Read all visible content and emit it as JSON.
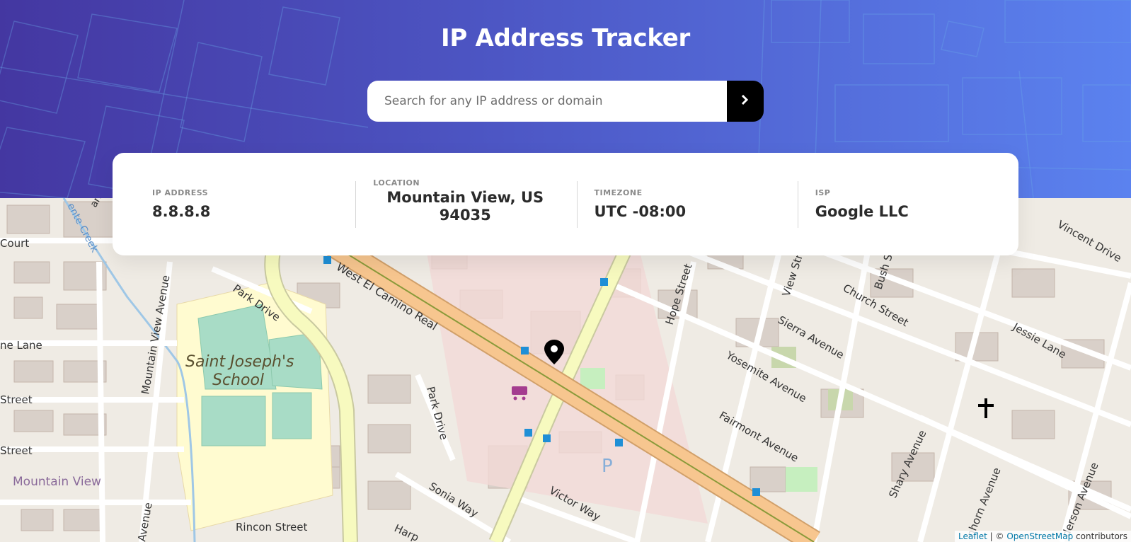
{
  "header": {
    "title": "IP Address Tracker"
  },
  "search": {
    "placeholder": "Search for any IP address or domain",
    "value": ""
  },
  "info": {
    "ip": {
      "label": "IP ADDRESS",
      "value": "8.8.8.8"
    },
    "location": {
      "label": "LOCATION",
      "value": "Mountain View, US 94035"
    },
    "timezone": {
      "label": "TIMEZONE",
      "value": "UTC -08:00"
    },
    "isp": {
      "label": "ISP",
      "value": "Google LLC"
    }
  },
  "map": {
    "labels": {
      "west_el_camino": "West El Camino Real",
      "park_drive_1": "Park Drive",
      "park_drive_2": "Park Drive",
      "mountain_view_ave": "Mountain View Avenue",
      "saint_josephs_1": "Saint Joseph's",
      "saint_josephs_2": "School",
      "hope_street": "Hope Street",
      "sierra_ave": "Sierra Avenue",
      "yosemite_ave": "Yosemite Avenue",
      "fairmont_ave": "Fairmont Avenue",
      "church_street": "Church Street",
      "bush_street": "Bush Stre",
      "view_street": "View Stre",
      "vincent_drive": "Vincent Drive",
      "jessie_lane": "Jessie Lane",
      "shary_ave": "Shary Avenue",
      "sonia_way": "Sonia Way",
      "victor_way": "Victor Way",
      "rincon_street": "Rincon Street",
      "mountain_view_city": "Mountain View",
      "court": "Court",
      "ne_lane": "ne Lane",
      "street_1": "Street",
      "street_2": "Street",
      "creek": "ente Creek",
      "linhorn": "nhorn Avenue",
      "anderson": "derson Avenue",
      "avenue_left": "Avenue",
      "harp": "Harp",
      "park_k": "ark"
    },
    "attribution": {
      "leaflet": "Leaflet",
      "sep": " | © ",
      "osm": "OpenStreetMap",
      "suffix": " contributors"
    }
  },
  "icons": {
    "search_button": "chevron-right-icon",
    "marker": "location-marker-icon"
  },
  "colors": {
    "gradient_start": "#4437a1",
    "gradient_end": "#5b82ef",
    "main_road": "#f7c68f",
    "secondary_road": "#f7fabf"
  }
}
